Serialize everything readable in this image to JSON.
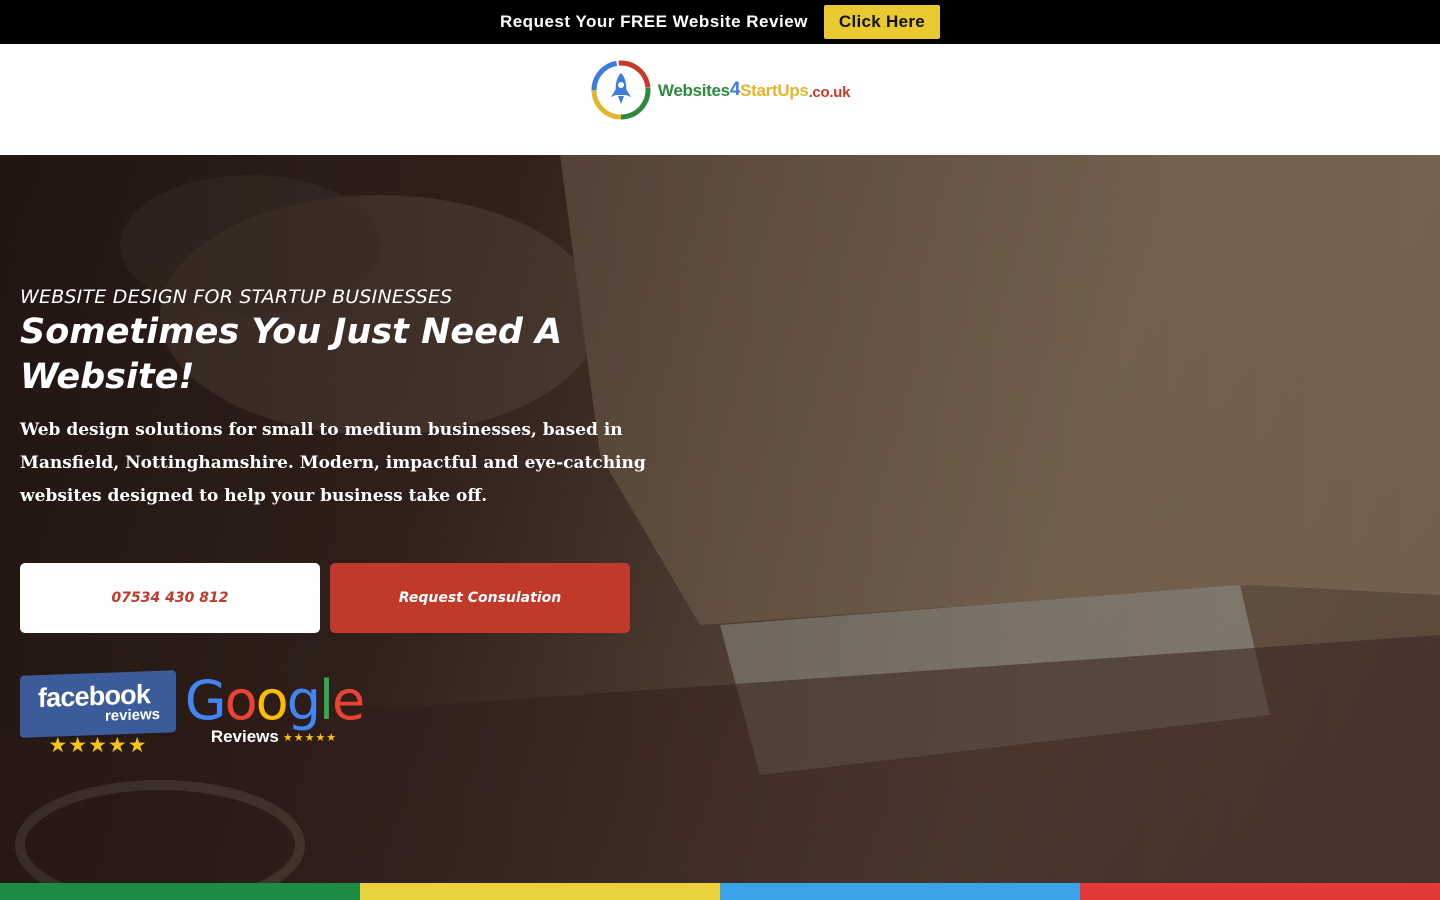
{
  "promo": {
    "text": "Request Your FREE Website Review",
    "button_label": "Click Here"
  },
  "header": {
    "logo": {
      "part_websites": "Websites",
      "part_4": "4",
      "part_startups": "StartUps",
      "part_domain": ".co.uk"
    }
  },
  "hero": {
    "eyebrow": "WEBSITE DESIGN FOR STARTUP BUSINESSES",
    "title": "Sometimes You Just Need A Website!",
    "description": "Web design solutions for small to medium businesses, based in Mansfield, Nottinghamshire. Modern, impactful and eye-catching websites designed to help your business take off.",
    "phone_button": "07534 430 812",
    "consult_button": "Request Consulation"
  },
  "badges": {
    "facebook": {
      "name": "facebook",
      "sub": "reviews",
      "stars": "★★★★★"
    },
    "google": {
      "g1": "G",
      "g2": "o",
      "g3": "o",
      "g4": "g",
      "g5": "l",
      "g6": "e",
      "sub": "Reviews",
      "stars": "★★★★★"
    }
  },
  "colors": {
    "promo_button": "#e8c930",
    "consult_button": "#c0392b",
    "strip": [
      "#1e8a44",
      "#e8d13a",
      "#3aa3e8",
      "#e63a3a"
    ]
  }
}
